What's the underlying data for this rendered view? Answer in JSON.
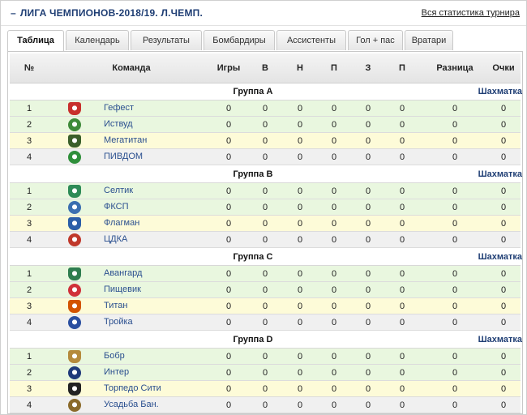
{
  "header": {
    "title": "ЛИГА ЧЕМПИОНОВ-2018/19. Л.ЧЕМП.",
    "collapse_glyph": "–",
    "stats_link": "Вся статистика турнира"
  },
  "tabs": [
    {
      "label": "Таблица",
      "active": true
    },
    {
      "label": "Календарь"
    },
    {
      "label": "Результаты"
    },
    {
      "label": "Бомбардиры"
    },
    {
      "label": "Ассистенты"
    },
    {
      "label": "Гол + пас"
    },
    {
      "label": "Вратари"
    }
  ],
  "table": {
    "columns": [
      "№",
      "Команда",
      "Игры",
      "В",
      "Н",
      "П",
      "З",
      "П",
      "Разница",
      "Очки"
    ],
    "chess_label": "Шахматка",
    "groups": [
      {
        "name": "Группа А",
        "teams": [
          {
            "pos": "1",
            "name": "Гефест",
            "logo_icon": "gefest-logo-icon",
            "color": "#c8302c",
            "stats": [
              "0",
              "0",
              "0",
              "0",
              "0",
              "0",
              "0",
              "0"
            ]
          },
          {
            "pos": "2",
            "name": "Иствуд",
            "logo_icon": "istvud-logo-icon",
            "color": "#3e8a3a",
            "stats": [
              "0",
              "0",
              "0",
              "0",
              "0",
              "0",
              "0",
              "0"
            ]
          },
          {
            "pos": "3",
            "name": "Мегатитан",
            "logo_icon": "megatitan-logo-icon",
            "color": "#3a5f2a",
            "stats": [
              "0",
              "0",
              "0",
              "0",
              "0",
              "0",
              "0",
              "0"
            ]
          },
          {
            "pos": "4",
            "name": "ПИВДОМ",
            "logo_icon": "pivdom-logo-icon",
            "color": "#2f8f3a",
            "stats": [
              "0",
              "0",
              "0",
              "0",
              "0",
              "0",
              "0",
              "0"
            ]
          }
        ]
      },
      {
        "name": "Группа В",
        "teams": [
          {
            "pos": "1",
            "name": "Селтик",
            "logo_icon": "seltik-logo-icon",
            "color": "#2e8b57",
            "stats": [
              "0",
              "0",
              "0",
              "0",
              "0",
              "0",
              "0",
              "0"
            ]
          },
          {
            "pos": "2",
            "name": "ФКСП",
            "logo_icon": "fksp-logo-icon",
            "color": "#3b6fb0",
            "stats": [
              "0",
              "0",
              "0",
              "0",
              "0",
              "0",
              "0",
              "0"
            ]
          },
          {
            "pos": "3",
            "name": "Флагман",
            "logo_icon": "flagman-logo-icon",
            "color": "#2b5ea8",
            "stats": [
              "0",
              "0",
              "0",
              "0",
              "0",
              "0",
              "0",
              "0"
            ]
          },
          {
            "pos": "4",
            "name": "ЦДКА",
            "logo_icon": "cdka-logo-icon",
            "color": "#c0392b",
            "stats": [
              "0",
              "0",
              "0",
              "0",
              "0",
              "0",
              "0",
              "0"
            ]
          }
        ]
      },
      {
        "name": "Группа С",
        "teams": [
          {
            "pos": "1",
            "name": "Авангард",
            "logo_icon": "avangard-logo-icon",
            "color": "#2e7d4f",
            "stats": [
              "0",
              "0",
              "0",
              "0",
              "0",
              "0",
              "0",
              "0"
            ]
          },
          {
            "pos": "2",
            "name": "Пищевик",
            "logo_icon": "pishchevik-logo-icon",
            "color": "#d0303a",
            "stats": [
              "0",
              "0",
              "0",
              "0",
              "0",
              "0",
              "0",
              "0"
            ]
          },
          {
            "pos": "3",
            "name": "Титан",
            "logo_icon": "titan-logo-icon",
            "color": "#d35400",
            "stats": [
              "0",
              "0",
              "0",
              "0",
              "0",
              "0",
              "0",
              "0"
            ]
          },
          {
            "pos": "4",
            "name": "Тройка",
            "logo_icon": "troika-logo-icon",
            "color": "#2a4fa0",
            "stats": [
              "0",
              "0",
              "0",
              "0",
              "0",
              "0",
              "0",
              "0"
            ]
          }
        ]
      },
      {
        "name": "Группа D",
        "teams": [
          {
            "pos": "1",
            "name": "Бобр",
            "logo_icon": "bobr-logo-icon",
            "color": "#b58a3c",
            "stats": [
              "0",
              "0",
              "0",
              "0",
              "0",
              "0",
              "0",
              "0"
            ]
          },
          {
            "pos": "2",
            "name": "Интер",
            "logo_icon": "inter-logo-icon",
            "color": "#1f3a7a",
            "stats": [
              "0",
              "0",
              "0",
              "0",
              "0",
              "0",
              "0",
              "0"
            ]
          },
          {
            "pos": "3",
            "name": "Торпедо Сити",
            "logo_icon": "torpedo-siti-logo-icon",
            "color": "#222222",
            "stats": [
              "0",
              "0",
              "0",
              "0",
              "0",
              "0",
              "0",
              "0"
            ]
          },
          {
            "pos": "4",
            "name": "Усадьба Бан.",
            "logo_icon": "usadba-ban-logo-icon",
            "color": "#8a6a2a",
            "stats": [
              "0",
              "0",
              "0",
              "0",
              "0",
              "0",
              "0",
              "0"
            ]
          }
        ]
      }
    ]
  },
  "colors": {
    "accent": "#1f3e74",
    "link": "#2a4f8f",
    "zone_green": "#e9f7df",
    "zone_yellow": "#fdfbd8",
    "zone_grey": "#f0f0f0"
  }
}
